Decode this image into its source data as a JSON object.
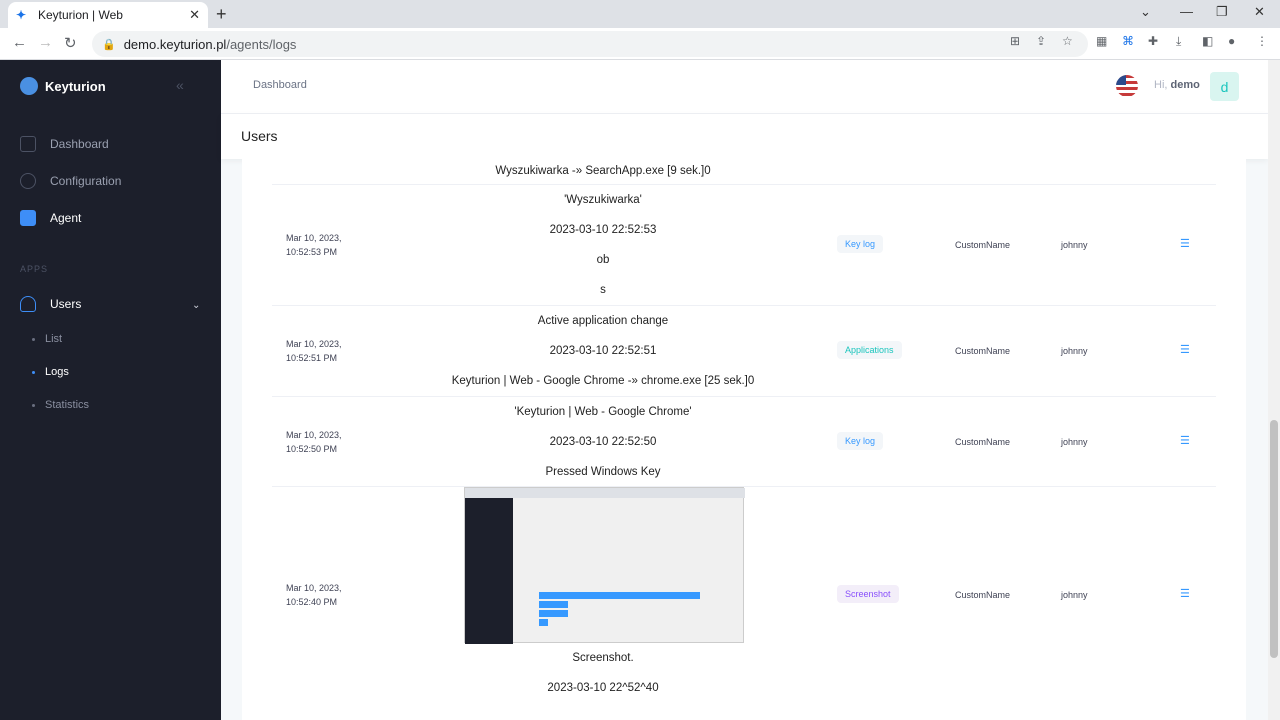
{
  "browser": {
    "tab_title": "Keyturion | Web",
    "url_domain": "demo.keyturion.pl",
    "url_path": "/agents/logs"
  },
  "sidebar": {
    "brand": "Keyturion",
    "items": [
      {
        "label": "Dashboard"
      },
      {
        "label": "Configuration"
      },
      {
        "label": "Agent"
      }
    ],
    "section_label": "APPS",
    "users_label": "Users",
    "subitems": [
      {
        "label": "List"
      },
      {
        "label": "Logs"
      },
      {
        "label": "Statistics"
      }
    ]
  },
  "header": {
    "breadcrumb": "Dashboard",
    "greeting": "Hi,",
    "username": "demo",
    "avatar_letter": "d"
  },
  "page": {
    "title": "Users"
  },
  "log_rows": [
    {
      "lines": [
        "Wyszukiwarka -» SearchApp.exe [9 sek.]0"
      ]
    },
    {
      "date": "Mar 10, 2023,",
      "time": "10:52:53 PM",
      "lines": [
        "'Wyszukiwarka'",
        "2023-03-10 22:52:53",
        "ob",
        "s"
      ],
      "badge": "Key log",
      "custom": "CustomName",
      "user": "johnny"
    },
    {
      "date": "Mar 10, 2023,",
      "time": "10:52:51 PM",
      "lines": [
        "Active application change",
        "2023-03-10 22:52:51",
        "Keyturion | Web - Google Chrome -» chrome.exe [25 sek.]0"
      ],
      "badge": "Applications",
      "custom": "CustomName",
      "user": "johnny"
    },
    {
      "date": "Mar 10, 2023,",
      "time": "10:52:50 PM",
      "lines": [
        "'Keyturion | Web - Google Chrome'",
        "2023-03-10 22:52:50",
        "Pressed Windows Key"
      ],
      "badge": "Key log",
      "custom": "CustomName",
      "user": "johnny"
    },
    {
      "date": "Mar 10, 2023,",
      "time": "10:52:40 PM",
      "lines": [
        "Screenshot.",
        "2023-03-10 22^52^40"
      ],
      "badge": "Screenshot",
      "custom": "CustomName",
      "user": "johnny"
    }
  ]
}
